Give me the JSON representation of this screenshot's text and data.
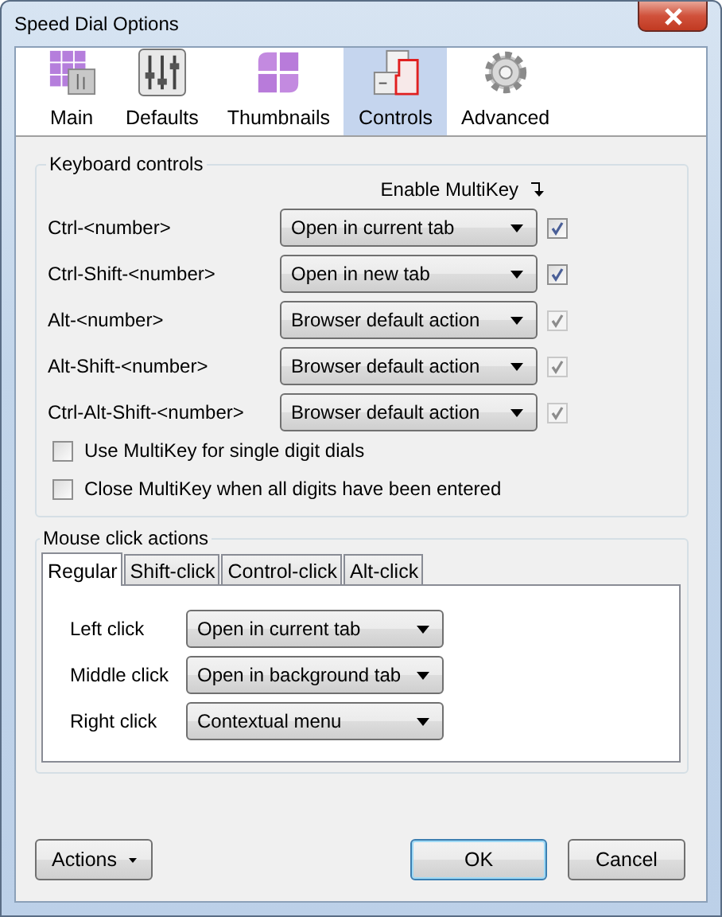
{
  "window": {
    "title": "Speed Dial Options"
  },
  "toolbar": [
    {
      "label": "Main",
      "kind": "grid",
      "selected": false
    },
    {
      "label": "Defaults",
      "kind": "sliders",
      "selected": false
    },
    {
      "label": "Thumbnails",
      "kind": "tiles",
      "selected": false
    },
    {
      "label": "Controls",
      "kind": "keys",
      "selected": true
    },
    {
      "label": "Advanced",
      "kind": "gear",
      "selected": false
    }
  ],
  "keyboard_controls": {
    "title": "Keyboard controls",
    "multikey_header": "Enable MultiKey",
    "rows": [
      {
        "label": "Ctrl-<number>",
        "action": "Open in current tab",
        "multikey_checked": true,
        "multikey_disabled": false
      },
      {
        "label": "Ctrl-Shift-<number>",
        "action": "Open in new tab",
        "multikey_checked": true,
        "multikey_disabled": false
      },
      {
        "label": "Alt-<number>",
        "action": "Browser default action",
        "multikey_checked": true,
        "multikey_disabled": true
      },
      {
        "label": "Alt-Shift-<number>",
        "action": "Browser default action",
        "multikey_checked": true,
        "multikey_disabled": true
      },
      {
        "label": "Ctrl-Alt-Shift-<number>",
        "action": "Browser default action",
        "multikey_checked": true,
        "multikey_disabled": true
      }
    ],
    "options": [
      {
        "label": "Use MultiKey for single digit dials",
        "checked": false
      },
      {
        "label": "Close MultiKey when all digits have been entered",
        "checked": false
      }
    ]
  },
  "mouse_click_actions": {
    "title": "Mouse click actions",
    "tabs": [
      {
        "label": "Regular",
        "selected": true
      },
      {
        "label": "Shift-click",
        "selected": false
      },
      {
        "label": "Control-click",
        "selected": false
      },
      {
        "label": "Alt-click",
        "selected": false
      }
    ],
    "rows": [
      {
        "label": "Left click",
        "action": "Open in current tab"
      },
      {
        "label": "Middle click",
        "action": "Open in background tab"
      },
      {
        "label": "Right click",
        "action": "Contextual menu"
      }
    ]
  },
  "buttons": [
    {
      "label": "Actions",
      "kind": "menu"
    },
    {
      "label": "OK",
      "kind": "default"
    },
    {
      "label": "Cancel",
      "kind": "plain"
    }
  ]
}
